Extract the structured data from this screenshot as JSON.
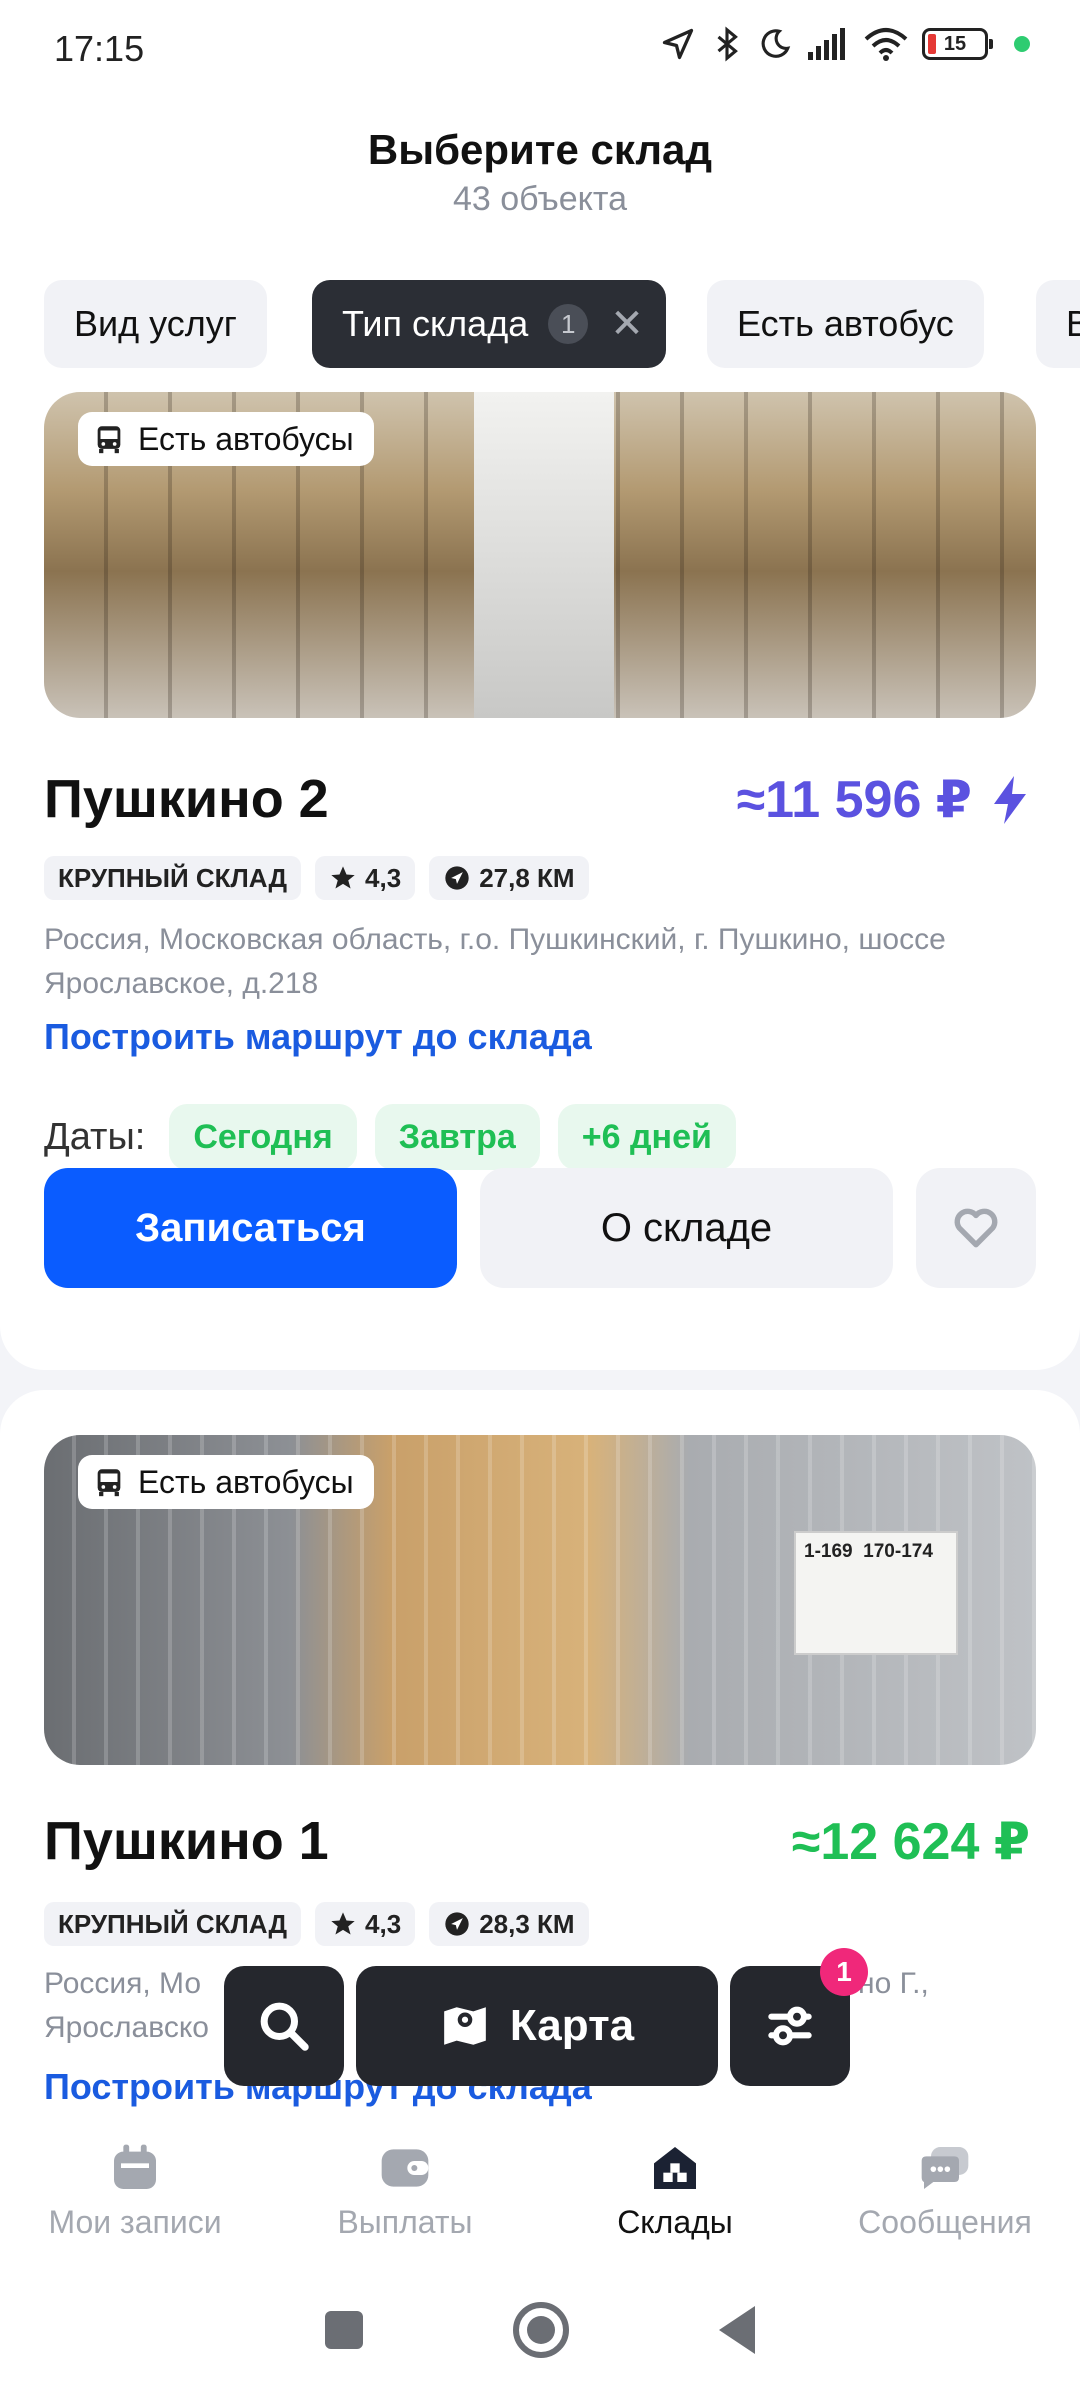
{
  "status_bar": {
    "time": "17:15",
    "battery": "15"
  },
  "header": {
    "title": "Выберите склад",
    "subtitle": "43 объекта"
  },
  "filters": [
    {
      "label": "Вид услуг"
    },
    {
      "label": "Тип склада",
      "count": "1"
    },
    {
      "label": "Есть автобус"
    },
    {
      "label": "В"
    }
  ],
  "warehouses": [
    {
      "badge": "Есть автобусы",
      "name": "Пушкино 2",
      "price": "≈11 596 ₽",
      "tags": {
        "type": "КРУПНЫЙ СКЛАД",
        "rating": "4,3",
        "distance": "27,8 КМ"
      },
      "address": "Россия, Московская область, г.о. Пушкинский, г. Пушкино, шоссе Ярославское, д.218",
      "route_link": "Построить маршрут до склада",
      "dates_label": "Даты:",
      "dates": [
        "Сегодня",
        "Завтра",
        "+6 дней"
      ],
      "book_label": "Записаться",
      "about_label": "О складе"
    },
    {
      "badge": "Есть автобусы",
      "name": "Пушкино 1",
      "price": "≈12 624 ₽",
      "tags": {
        "type": "КРУПНЫЙ СКЛАД",
        "rating": "4,3",
        "distance": "28,3 КМ"
      },
      "address": "Россия, Мо",
      "address_tail": "но Г.,",
      "address_line2": "Ярославско",
      "route_link": "Построить маршрут до склада",
      "photo_sign": [
        "1-169",
        "170-174"
      ]
    }
  ],
  "floating_bar": {
    "map_label": "Карта",
    "filter_badge": "1"
  },
  "bottom_nav": [
    {
      "label": "Мои записи",
      "icon": "calendar-icon"
    },
    {
      "label": "Выплаты",
      "icon": "wallet-icon"
    },
    {
      "label": "Склады",
      "icon": "warehouse-icon"
    },
    {
      "label": "Сообщения",
      "icon": "chat-icon"
    }
  ],
  "colors": {
    "primary": "#0a5cff",
    "price_purple": "#5b52e0",
    "price_green": "#1fbf55",
    "badge_pink": "#f0287a"
  }
}
